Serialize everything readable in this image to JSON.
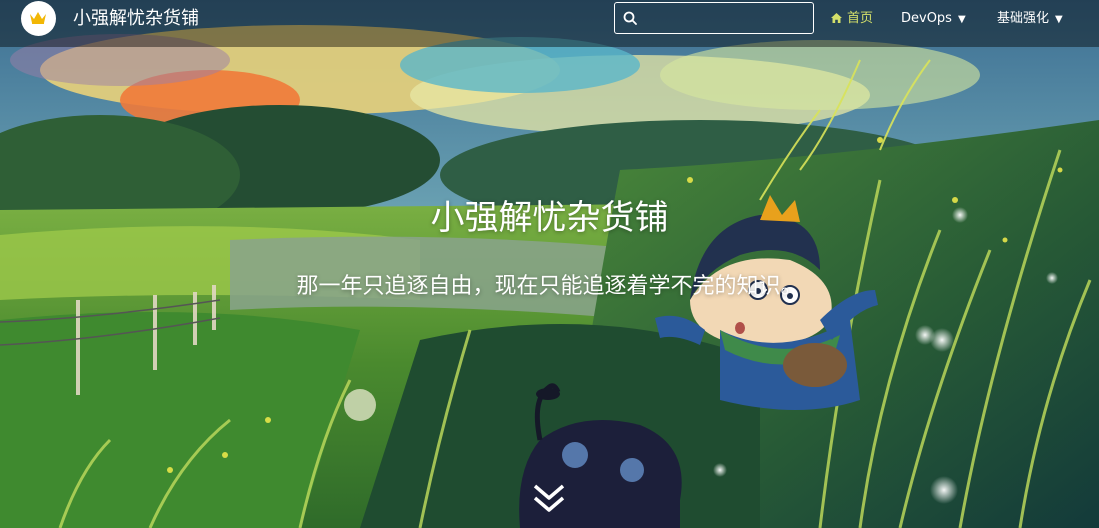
{
  "navbar": {
    "site_title": "小强解忧杂货铺",
    "logo_icon": "crown-icon",
    "search": {
      "value": "",
      "placeholder": "",
      "icon": "search-icon"
    },
    "items": [
      {
        "label": "首页",
        "icon": "home-icon",
        "active": true
      },
      {
        "label": "DevOps",
        "dropdown": true
      },
      {
        "label": "基础强化",
        "dropdown": true
      }
    ]
  },
  "hero": {
    "title": "小强解忧杂货铺",
    "subtitle": "那一年只追逐自由，现在只能追逐着学不完的知识。",
    "scroll_icon": "double-chevron-down-icon"
  },
  "colors": {
    "active_nav": "#d4e06a",
    "navbar_bg": "rgba(0,0,0,0.42)",
    "crown": "#f2b705"
  }
}
